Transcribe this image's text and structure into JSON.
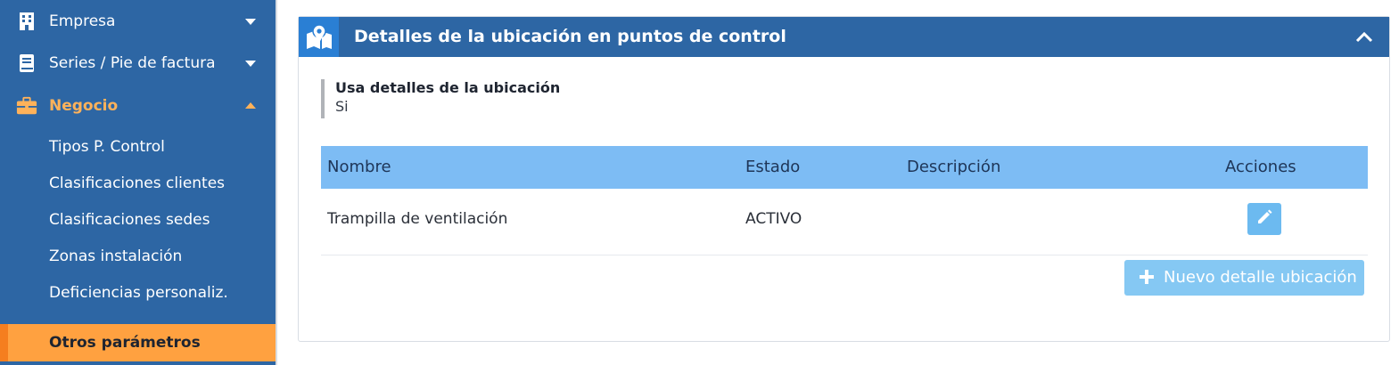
{
  "sidebar": {
    "items": [
      {
        "label": "Empresa",
        "icon": "building-icon"
      },
      {
        "label": "Series / Pie de factura",
        "icon": "book-icon"
      },
      {
        "label": "Negocio",
        "icon": "briefcase-icon"
      }
    ],
    "subitems": [
      {
        "label": "Tipos P. Control"
      },
      {
        "label": "Clasificaciones clientes"
      },
      {
        "label": "Clasificaciones sedes"
      },
      {
        "label": "Zonas instalación"
      },
      {
        "label": "Deficiencias personaliz."
      }
    ],
    "selected": {
      "label": "Otros parámetros"
    }
  },
  "panel": {
    "title": "Detalles de la ubicación en puntos de control",
    "icon": "map-marker-icon",
    "setting": {
      "label": "Usa detalles de la ubicación",
      "value": "Si"
    },
    "table": {
      "columns": [
        "Nombre",
        "Estado",
        "Descripción",
        "Acciones"
      ],
      "rows": [
        {
          "nombre": "Trampilla de ventilación",
          "estado": "ACTIVO",
          "descripcion": ""
        }
      ]
    },
    "new_button_label": "Nuevo detalle ubicación"
  },
  "colors": {
    "sidebar_bg": "#2d66a4",
    "active_text": "#ffb25a",
    "selected_bg": "#ffa140",
    "table_header_bg": "#7dbcf4",
    "button_bg": "#85c8f3"
  }
}
